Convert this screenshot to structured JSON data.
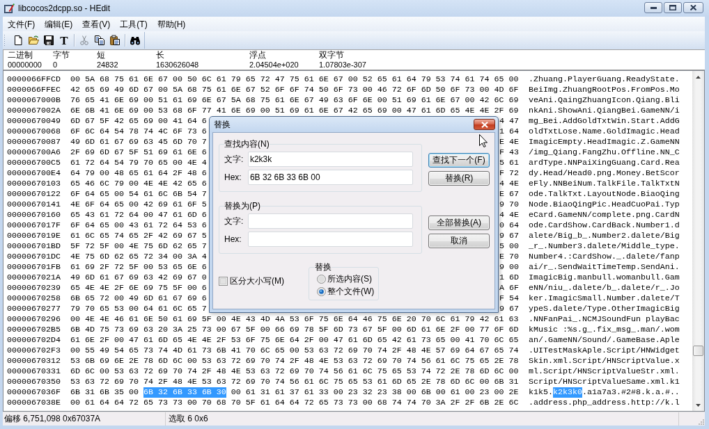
{
  "window": {
    "title": "libcocos2dcpp.so - HEdit"
  },
  "menu": [
    "文件(F)",
    "编辑(E)",
    "查看(V)",
    "工具(T)",
    "帮助(H)"
  ],
  "toolbar": [
    {
      "kind": "new",
      "disabled": false
    },
    {
      "kind": "open",
      "disabled": false
    },
    {
      "kind": "save",
      "disabled": false
    },
    {
      "kind": "font",
      "glyph": "T",
      "disabled": false
    },
    {
      "kind": "separator"
    },
    {
      "kind": "cut",
      "disabled": true
    },
    {
      "kind": "copy",
      "disabled": false
    },
    {
      "kind": "paste",
      "disabled": false
    },
    {
      "kind": "separator"
    },
    {
      "kind": "find",
      "disabled": false
    }
  ],
  "info_bar": [
    {
      "label": "二进制",
      "value": "00000000"
    },
    {
      "label": "字节",
      "value": "0"
    },
    {
      "label": "短",
      "value": "24832"
    },
    {
      "label": "长",
      "value": "1630626048"
    },
    {
      "label": "浮点",
      "value": "2.04504e+020"
    },
    {
      "label": "双字节",
      "value": "1.07803e-307"
    }
  ],
  "hex_view": {
    "rows": [
      {
        "address": "0000066FFCD",
        "hex": "00 5A 68 75 61 6E 67 00 50 6C 61 79 65 72 47 75 61 6E 67 00 52 65 61 64 79 53 74 61 74 65 00",
        "ascii": ".Zhuang.PlayerGuang.ReadyState."
      },
      {
        "address": "0000066FFEC",
        "hex": "42 65 69 49 6D 67 00 5A 68 75 61 6E 67 52 6F 6F 74 50 6F 73 00 46 72 6F 6D 50 6F 73 00 4D 6F",
        "ascii": "BeiImg.ZhuangRootPos.FromPos.Mo"
      },
      {
        "address": "0000067000B",
        "hex": "76 65 41 6E 69 00 51 61 69 6E 67 5A 68 75 61 6E 67 49 63 6F 6E 00 51 69 61 6E 67 00 42 6C 69",
        "ascii": "veAni.QaingZhuangIcon.Qiang.Bli"
      },
      {
        "address": "0000067002A",
        "hex": "6E 6B 41 6E 69 00 53 68 6F 77 41 6E 69 00 51 69 61 6E 67 42 65 69 00 47 61 6D 65 4E 4E 2F 69",
        "ascii": "nkAni.ShowAni.QiangBei.GameNN/i"
      },
      {
        "address": "00000670049",
        "hex_left": "6D 67 5F 42 65 69 00 41 64 6",
        "hex_right": "4 47",
        "ascii": "mg_Bei.AddGoldTxtWin.Start.AddG"
      },
      {
        "address": "00000670068",
        "hex_left": "6F 6C 64 54 78 74 4C 6F 73 6",
        "hex_right": "1 64",
        "ascii": "oldTxtLose.Name.GoldImagic.Head"
      },
      {
        "address": "00000670087",
        "hex_left": "49 6D 61 67 69 63 45 6D 70 7",
        "hex_right": "E 4E",
        "ascii": "ImagicEmpty.HeadImagic.Z.GameNN"
      },
      {
        "address": "000006700A6",
        "hex_left": "2F 69 6D 67 5F 51 69 61 6E 6",
        "hex_right": "F 43",
        "ascii": "/img_Qiang.FangZhu.Offline.NN_C"
      },
      {
        "address": "000006700C5",
        "hex_left": "61 72 64 54 79 70 65 00 4E 4",
        "hex_right": "5 61",
        "ascii": "ardType.NNPaiXingGuang.Card.Rea"
      },
      {
        "address": "000006700E4",
        "hex_left": "64 79 00 48 65 61 64 2F 48 6",
        "hex_right": "F 72",
        "ascii": "dy.Head/Head0.png.Money.BetScor"
      },
      {
        "address": "00000670103",
        "hex_left": "65 46 6C 79 00 4E 4E 42 65 6",
        "hex_right": "4 4E",
        "ascii": "eFly.NNBeiNum.TalkFile.TalkTxtN"
      },
      {
        "address": "00000670122",
        "hex_left": "6F 64 65 00 54 61 6C 6B 54 7",
        "hex_right": "E 67",
        "ascii": "ode.TalkTxt.LayoutNode.BiaoQing"
      },
      {
        "address": "00000670141",
        "hex_left": "4E 6F 64 65 00 42 69 61 6F 5",
        "hex_right": "9 70",
        "ascii": "Node.BiaoQingPic.HeadCuoPai.Typ"
      },
      {
        "address": "00000670160",
        "hex_left": "65 43 61 72 64 00 47 61 6D 6",
        "hex_right": "4 4E",
        "ascii": "eCard.GameNN/complete.png.CardN"
      },
      {
        "address": "0000067017F",
        "hex_left": "6F 64 65 00 43 61 72 64 53 6",
        "hex_right": "0 64",
        "ascii": "ode.CardShow.CardBack.Number1.d"
      },
      {
        "address": "0000067019E",
        "hex_left": "61 6C 65 74 65 2F 42 69 67 5",
        "hex_right": "9 67",
        "ascii": "alete/Big_b_.Number2.dalete/Big"
      },
      {
        "address": "000006701BD",
        "hex_left": "5F 72 5F 00 4E 75 6D 62 65 7",
        "hex_right": "5 00",
        "ascii": "_r_.Number3.dalete/Middle_type."
      },
      {
        "address": "000006701DC",
        "hex_left": "4E 75 6D 62 65 72 34 00 3A 4",
        "hex_right": "E 70",
        "ascii": "Number4.:CardShow._.dalete/fanp"
      },
      {
        "address": "000006701FB",
        "hex_left": "61 69 2F 72 5F 00 53 65 6E 6",
        "hex_right": "9 00",
        "ascii": "ai/r_.SendWaitTimeTemp.SendAni."
      },
      {
        "address": "0000067021A",
        "hex_left": "49 6D 61 67 69 63 42 69 67 0",
        "hex_right": "1 6D",
        "ascii": "ImagicBig.manbull.womanbull.Gam"
      },
      {
        "address": "00000670239",
        "hex_left": "65 4E 4E 2F 6E 69 75 5F 00 6",
        "hex_right": "A 6F",
        "ascii": "eNN/niu_.dalete/b_.dalete/r_.Jo"
      },
      {
        "address": "00000670258",
        "hex_left": "6B 65 72 00 49 6D 61 67 69 6",
        "hex_right": "F 54",
        "ascii": "ker.ImagicSmall.Number.dalete/T"
      },
      {
        "address": "00000670277",
        "hex_left": "79 70 65 53 00 64 61 6C 65 7",
        "hex_right": "9 67",
        "ascii": "ypeS.dalete/Type.OtherImagicBig"
      },
      {
        "address": "00000670296",
        "hex": "00 4E 4E 46 61 6E 50 61 69 5F 00 4E 43 4D 4A 53 6F 75 6E 64 46 75 6E 20 70 6C 61 79 42 61 63",
        "ascii": ".NNFanPai_.NCMJSoundFun playBac"
      },
      {
        "address": "000006702B5",
        "hex": "6B 4D 75 73 69 63 20 3A 25 73 00 67 5F 00 66 69 78 5F 6D 73 67 5F 00 6D 61 6E 2F 00 77 6F 6D",
        "ascii": "kMusic :%s.g_.fix_msg_.man/.wom"
      },
      {
        "address": "000006702D4",
        "hex": "61 6E 2F 00 47 61 6D 65 4E 4E 2F 53 6F 75 6E 64 2F 00 47 61 6D 65 42 61 73 65 00 41 70 6C 65",
        "ascii": "an/.GameNN/Sound/.GameBase.Aple"
      },
      {
        "address": "000006702F3",
        "hex": "00 55 49 54 65 73 74 4D 61 73 6B 41 70 6C 65 00 53 63 72 69 70 74 2F 48 4E 57 69 64 67 65 74",
        "ascii": ".UITestMaskAple.Script/HNWidget"
      },
      {
        "address": "00000670312",
        "hex": "53 6B 69 6E 2E 78 6D 6C 00 53 63 72 69 70 74 2F 48 4E 53 63 72 69 70 74 56 61 6C 75 65 2E 78",
        "ascii": "Skin.xml.Script/HNScriptValue.x"
      },
      {
        "address": "00000670331",
        "hex": "6D 6C 00 53 63 72 69 70 74 2F 48 4E 53 63 72 69 70 74 56 61 6C 75 65 53 74 72 2E 78 6D 6C 00",
        "ascii": "ml.Script/HNScriptValueStr.xml."
      },
      {
        "address": "00000670350",
        "hex": "53 63 72 69 70 74 2F 48 4E 53 63 72 69 70 74 56 61 6C 75 65 53 61 6D 65 2E 78 6D 6C 00 6B 31",
        "ascii": "Script/HNScriptValueSame.xml.k1"
      },
      {
        "address": "0000067036F",
        "hex_parts": [
          {
            "text": "6B 31 6B 35 00",
            "selected": false
          },
          {
            "text": "6B 32 6B 33 6B 30",
            "selected": true
          },
          {
            "text": "00 61 31 61 37 61 33 00 23 32 23 38 00 6B 00 61 00 23 00 2E",
            "selected": false
          }
        ],
        "ascii_parts": [
          {
            "text": "k1k5.",
            "selected": false
          },
          {
            "text": "k2k3k0",
            "selected": true
          },
          {
            "text": ".a1a7a3.#2#8.k.a.#..",
            "selected": false
          }
        ]
      },
      {
        "address": "0000067038E",
        "hex": "00 61 64 64 72 65 73 73 00 70 68 70 5F 61 64 64 72 65 73 73 00 68 74 74 70 3A 2F 2F 6B 2E 6C",
        "ascii": ".address.php_address.http://k.l"
      }
    ]
  },
  "status_bar": [
    "偏移 6,751,098 0x67037A",
    "选取 6 0x6"
  ],
  "dialog": {
    "title": "替换",
    "find_group": {
      "label": "查找内容(N)",
      "fields": [
        {
          "label": "文字:",
          "value": "k2k3k"
        },
        {
          "label": "Hex:",
          "value": "6B 32 6B 33 6B 00"
        }
      ]
    },
    "replace_group": {
      "label": "替换为(P)",
      "fields": [
        {
          "label": "文字:"
        },
        {
          "label": "Hex:"
        }
      ]
    },
    "find_buttons": [
      {
        "label": "查找下一个(F)",
        "default": true
      },
      {
        "label": "替换(R)",
        "default": false
      }
    ],
    "replace_buttons": [
      {
        "label": "全部替换(A)",
        "default": false
      },
      {
        "label": "取消",
        "default": false
      }
    ],
    "match_case": {
      "label": "区分大小写(M)",
      "checked": false
    },
    "scope": {
      "label": "替换",
      "options": [
        {
          "label": "所选内容(S)",
          "selected": false
        },
        {
          "label": "整个文件(W)",
          "selected": true
        }
      ]
    }
  }
}
